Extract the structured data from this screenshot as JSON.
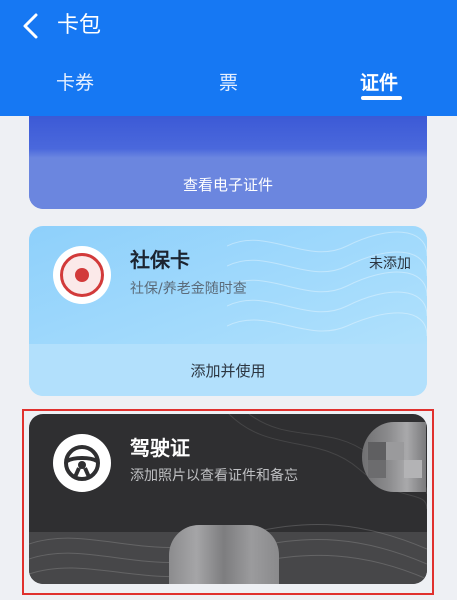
{
  "header": {
    "title": "卡包",
    "tabs": [
      {
        "label": "卡券",
        "active": false
      },
      {
        "label": "票",
        "active": false
      },
      {
        "label": "证件",
        "active": true
      }
    ],
    "background_color": "#1678f3"
  },
  "cards": {
    "id_card": {
      "action_label": "查看电子证件",
      "color": "#4a68dc"
    },
    "social_security": {
      "name": "社保卡",
      "description": "社保/养老金随时查",
      "status": "未添加",
      "action_label": "添加并使用",
      "logo_icon": "social-security-seal-icon",
      "color": "#a6dcfc"
    },
    "drivers_license": {
      "name": "驾驶证",
      "description": "添加照片以查看证件和备忘",
      "icon": "steering-wheel-icon",
      "color": "#2f2f31",
      "highlighted": true,
      "highlight_color": "#e0312e"
    }
  }
}
